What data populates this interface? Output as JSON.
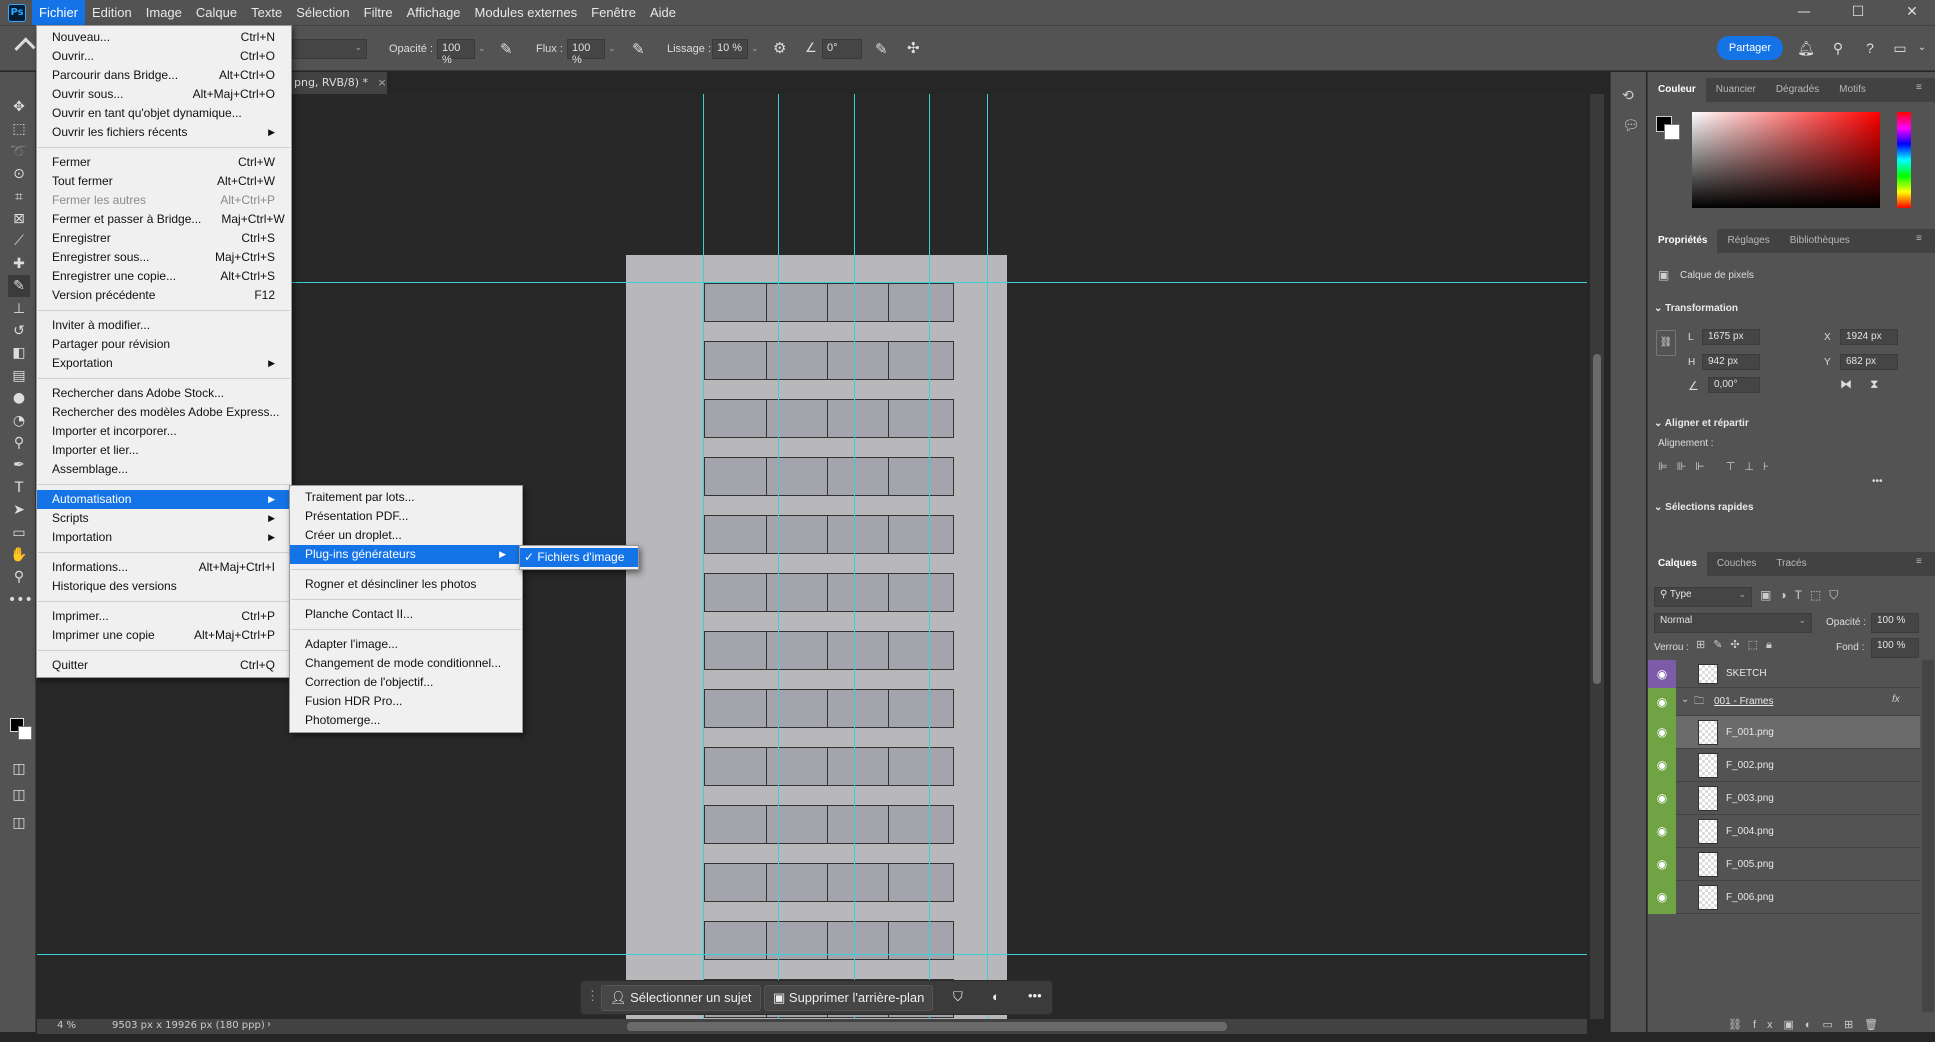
{
  "app": {
    "logo": "Ps",
    "window_controls": [
      "—",
      "☐",
      "✕"
    ]
  },
  "menubar": [
    "Fichier",
    "Edition",
    "Image",
    "Calque",
    "Texte",
    "Sélection",
    "Filtre",
    "Affichage",
    "Modules externes",
    "Fenêtre",
    "Aide"
  ],
  "options": {
    "opacity_label": "Opacité :",
    "opacity_value": "100 %",
    "flow_label": "Flux :",
    "flow_value": "100 %",
    "smoothing_label": "Lissage :",
    "smoothing_value": "10 %",
    "angle_value": "0°",
    "share_label": "Partager"
  },
  "document": {
    "tab_title": "png, RVB/8) *",
    "zoom": "4 %",
    "dimensions": "9503 px x 19926 px (180 ppp)"
  },
  "file_menu": [
    {
      "label": "Nouveau...",
      "shortcut": "Ctrl+N"
    },
    {
      "label": "Ouvrir...",
      "shortcut": "Ctrl+O"
    },
    {
      "label": "Parcourir dans Bridge...",
      "shortcut": "Alt+Ctrl+O"
    },
    {
      "label": "Ouvrir sous...",
      "shortcut": "Alt+Maj+Ctrl+O"
    },
    {
      "label": "Ouvrir en tant qu'objet dynamique...",
      "shortcut": ""
    },
    {
      "label": "Ouvrir les fichiers récents",
      "shortcut": "",
      "submenu": true
    },
    {
      "sep": true
    },
    {
      "label": "Fermer",
      "shortcut": "Ctrl+W"
    },
    {
      "label": "Tout fermer",
      "shortcut": "Alt+Ctrl+W"
    },
    {
      "label": "Fermer les autres",
      "shortcut": "Alt+Ctrl+P",
      "disabled": true
    },
    {
      "label": "Fermer et passer à Bridge...",
      "shortcut": "Maj+Ctrl+W"
    },
    {
      "label": "Enregistrer",
      "shortcut": "Ctrl+S"
    },
    {
      "label": "Enregistrer sous...",
      "shortcut": "Maj+Ctrl+S"
    },
    {
      "label": "Enregistrer une copie...",
      "shortcut": "Alt+Ctrl+S"
    },
    {
      "label": "Version précédente",
      "shortcut": "F12"
    },
    {
      "sep": true
    },
    {
      "label": "Inviter à modifier...",
      "shortcut": ""
    },
    {
      "label": "Partager pour révision",
      "shortcut": ""
    },
    {
      "label": "Exportation",
      "shortcut": "",
      "submenu": true
    },
    {
      "sep": true
    },
    {
      "label": "Rechercher dans Adobe Stock...",
      "shortcut": ""
    },
    {
      "label": "Rechercher des modèles Adobe Express...",
      "shortcut": ""
    },
    {
      "label": "Importer et incorporer...",
      "shortcut": ""
    },
    {
      "label": "Importer et lier...",
      "shortcut": ""
    },
    {
      "label": "Assemblage...",
      "shortcut": ""
    },
    {
      "sep": true
    },
    {
      "label": "Automatisation",
      "shortcut": "",
      "submenu": true,
      "highlight": true
    },
    {
      "label": "Scripts",
      "shortcut": "",
      "submenu": true
    },
    {
      "label": "Importation",
      "shortcut": "",
      "submenu": true
    },
    {
      "sep": true
    },
    {
      "label": "Informations...",
      "shortcut": "Alt+Maj+Ctrl+I"
    },
    {
      "label": "Historique des versions",
      "shortcut": ""
    },
    {
      "sep": true
    },
    {
      "label": "Imprimer...",
      "shortcut": "Ctrl+P"
    },
    {
      "label": "Imprimer une copie",
      "shortcut": "Alt+Maj+Ctrl+P"
    },
    {
      "sep": true
    },
    {
      "label": "Quitter",
      "shortcut": "Ctrl+Q"
    }
  ],
  "automation_menu": [
    {
      "label": "Traitement par lots..."
    },
    {
      "label": "Présentation PDF..."
    },
    {
      "label": "Créer un droplet..."
    },
    {
      "label": "Plug-ins générateurs",
      "submenu": true,
      "highlight": true
    },
    {
      "sep": true
    },
    {
      "label": "Rogner et désincliner les photos"
    },
    {
      "sep": true
    },
    {
      "label": "Planche Contact II..."
    },
    {
      "sep": true
    },
    {
      "label": "Adapter l'image..."
    },
    {
      "label": "Changement de mode conditionnel..."
    },
    {
      "label": "Correction de l'objectif..."
    },
    {
      "label": "Fusion HDR Pro..."
    },
    {
      "label": "Photomerge..."
    }
  ],
  "generator_menu": {
    "check": "✓",
    "label": "Fichiers d'image"
  },
  "context_bar": {
    "select_subject": "Sélectionner un sujet",
    "remove_bg": "Supprimer l'arrière-plan"
  },
  "color_panel": {
    "tabs": [
      "Couleur",
      "Nuancier",
      "Dégradés",
      "Motifs"
    ]
  },
  "properties_panel": {
    "tabs": [
      "Propriétés",
      "Réglages",
      "Bibliothèques"
    ],
    "layer_type": "Calque de pixels",
    "transform_title": "Transformation",
    "L_label": "L",
    "L_value": "1675 px",
    "H_label": "H",
    "H_value": "942 px",
    "X_label": "X",
    "X_value": "1924 px",
    "Y_label": "Y",
    "Y_value": "682 px",
    "angle_value": "0,00°",
    "align_title": "Aligner et répartir",
    "align_label": "Alignement :",
    "quick_title": "Sélections rapides",
    "more": "•••"
  },
  "layers_panel": {
    "tabs": [
      "Calques",
      "Couches",
      "Tracés"
    ],
    "filter": "Type",
    "blend": "Normal",
    "opacity_label": "Opacité :",
    "opacity_value": "100 %",
    "lock_label": "Verrou :",
    "fill_label": "Fond :",
    "fill_value": "100 %",
    "layers": [
      {
        "name": "SKETCH",
        "color": "#7c5ca8"
      },
      {
        "name": "001 - Frames",
        "group": true,
        "color": "#6fa343"
      },
      {
        "name": "F_001.png",
        "color": "#6fa343",
        "selected": true
      },
      {
        "name": "F_002.png",
        "color": "#6fa343"
      },
      {
        "name": "F_003.png",
        "color": "#6fa343"
      },
      {
        "name": "F_004.png",
        "color": "#6fa343"
      },
      {
        "name": "F_005.png",
        "color": "#6fa343"
      },
      {
        "name": "F_006.png",
        "color": "#6fa343"
      }
    ]
  },
  "colors": {
    "accent": "#1473e6",
    "guide": "#3ad0d8",
    "label_green": "#6fa343",
    "label_purple": "#7c5ca8"
  }
}
